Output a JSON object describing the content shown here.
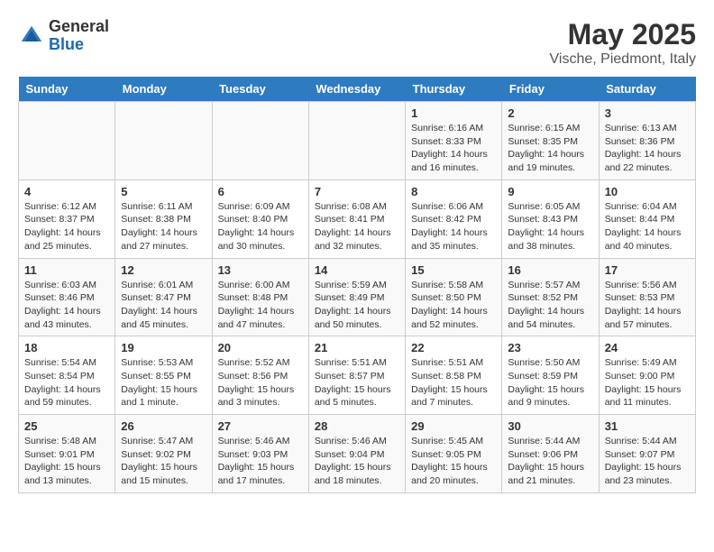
{
  "logo": {
    "general": "General",
    "blue": "Blue"
  },
  "title": "May 2025",
  "location": "Vische, Piedmont, Italy",
  "weekdays": [
    "Sunday",
    "Monday",
    "Tuesday",
    "Wednesday",
    "Thursday",
    "Friday",
    "Saturday"
  ],
  "weeks": [
    [
      {
        "day": "",
        "info": ""
      },
      {
        "day": "",
        "info": ""
      },
      {
        "day": "",
        "info": ""
      },
      {
        "day": "",
        "info": ""
      },
      {
        "day": "1",
        "info": "Sunrise: 6:16 AM\nSunset: 8:33 PM\nDaylight: 14 hours\nand 16 minutes."
      },
      {
        "day": "2",
        "info": "Sunrise: 6:15 AM\nSunset: 8:35 PM\nDaylight: 14 hours\nand 19 minutes."
      },
      {
        "day": "3",
        "info": "Sunrise: 6:13 AM\nSunset: 8:36 PM\nDaylight: 14 hours\nand 22 minutes."
      }
    ],
    [
      {
        "day": "4",
        "info": "Sunrise: 6:12 AM\nSunset: 8:37 PM\nDaylight: 14 hours\nand 25 minutes."
      },
      {
        "day": "5",
        "info": "Sunrise: 6:11 AM\nSunset: 8:38 PM\nDaylight: 14 hours\nand 27 minutes."
      },
      {
        "day": "6",
        "info": "Sunrise: 6:09 AM\nSunset: 8:40 PM\nDaylight: 14 hours\nand 30 minutes."
      },
      {
        "day": "7",
        "info": "Sunrise: 6:08 AM\nSunset: 8:41 PM\nDaylight: 14 hours\nand 32 minutes."
      },
      {
        "day": "8",
        "info": "Sunrise: 6:06 AM\nSunset: 8:42 PM\nDaylight: 14 hours\nand 35 minutes."
      },
      {
        "day": "9",
        "info": "Sunrise: 6:05 AM\nSunset: 8:43 PM\nDaylight: 14 hours\nand 38 minutes."
      },
      {
        "day": "10",
        "info": "Sunrise: 6:04 AM\nSunset: 8:44 PM\nDaylight: 14 hours\nand 40 minutes."
      }
    ],
    [
      {
        "day": "11",
        "info": "Sunrise: 6:03 AM\nSunset: 8:46 PM\nDaylight: 14 hours\nand 43 minutes."
      },
      {
        "day": "12",
        "info": "Sunrise: 6:01 AM\nSunset: 8:47 PM\nDaylight: 14 hours\nand 45 minutes."
      },
      {
        "day": "13",
        "info": "Sunrise: 6:00 AM\nSunset: 8:48 PM\nDaylight: 14 hours\nand 47 minutes."
      },
      {
        "day": "14",
        "info": "Sunrise: 5:59 AM\nSunset: 8:49 PM\nDaylight: 14 hours\nand 50 minutes."
      },
      {
        "day": "15",
        "info": "Sunrise: 5:58 AM\nSunset: 8:50 PM\nDaylight: 14 hours\nand 52 minutes."
      },
      {
        "day": "16",
        "info": "Sunrise: 5:57 AM\nSunset: 8:52 PM\nDaylight: 14 hours\nand 54 minutes."
      },
      {
        "day": "17",
        "info": "Sunrise: 5:56 AM\nSunset: 8:53 PM\nDaylight: 14 hours\nand 57 minutes."
      }
    ],
    [
      {
        "day": "18",
        "info": "Sunrise: 5:54 AM\nSunset: 8:54 PM\nDaylight: 14 hours\nand 59 minutes."
      },
      {
        "day": "19",
        "info": "Sunrise: 5:53 AM\nSunset: 8:55 PM\nDaylight: 15 hours\nand 1 minute."
      },
      {
        "day": "20",
        "info": "Sunrise: 5:52 AM\nSunset: 8:56 PM\nDaylight: 15 hours\nand 3 minutes."
      },
      {
        "day": "21",
        "info": "Sunrise: 5:51 AM\nSunset: 8:57 PM\nDaylight: 15 hours\nand 5 minutes."
      },
      {
        "day": "22",
        "info": "Sunrise: 5:51 AM\nSunset: 8:58 PM\nDaylight: 15 hours\nand 7 minutes."
      },
      {
        "day": "23",
        "info": "Sunrise: 5:50 AM\nSunset: 8:59 PM\nDaylight: 15 hours\nand 9 minutes."
      },
      {
        "day": "24",
        "info": "Sunrise: 5:49 AM\nSunset: 9:00 PM\nDaylight: 15 hours\nand 11 minutes."
      }
    ],
    [
      {
        "day": "25",
        "info": "Sunrise: 5:48 AM\nSunset: 9:01 PM\nDaylight: 15 hours\nand 13 minutes."
      },
      {
        "day": "26",
        "info": "Sunrise: 5:47 AM\nSunset: 9:02 PM\nDaylight: 15 hours\nand 15 minutes."
      },
      {
        "day": "27",
        "info": "Sunrise: 5:46 AM\nSunset: 9:03 PM\nDaylight: 15 hours\nand 17 minutes."
      },
      {
        "day": "28",
        "info": "Sunrise: 5:46 AM\nSunset: 9:04 PM\nDaylight: 15 hours\nand 18 minutes."
      },
      {
        "day": "29",
        "info": "Sunrise: 5:45 AM\nSunset: 9:05 PM\nDaylight: 15 hours\nand 20 minutes."
      },
      {
        "day": "30",
        "info": "Sunrise: 5:44 AM\nSunset: 9:06 PM\nDaylight: 15 hours\nand 21 minutes."
      },
      {
        "day": "31",
        "info": "Sunrise: 5:44 AM\nSunset: 9:07 PM\nDaylight: 15 hours\nand 23 minutes."
      }
    ]
  ]
}
